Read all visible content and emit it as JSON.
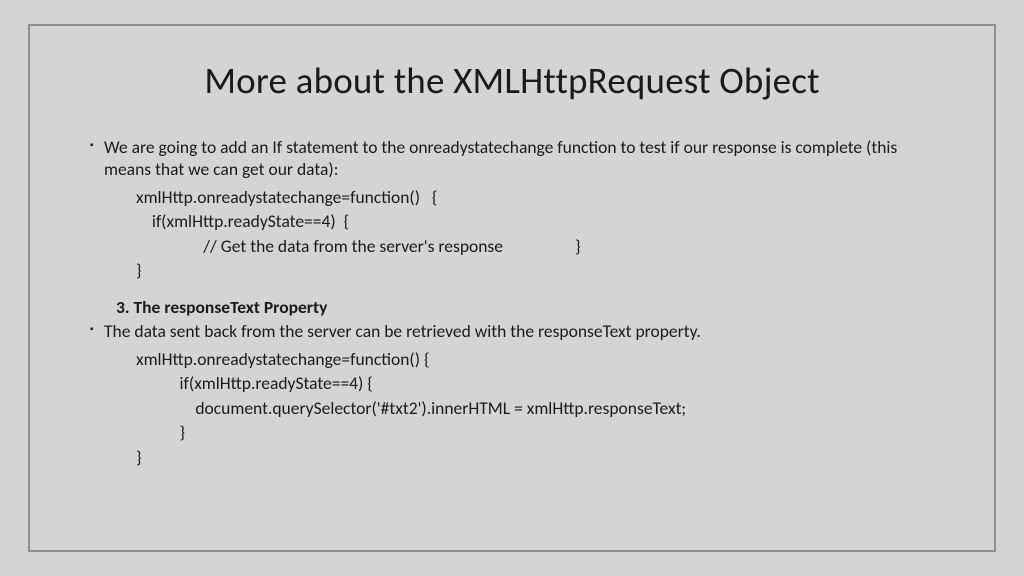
{
  "title": "More about the XMLHttpRequest Object",
  "bullet1": "We are going to add an If statement to the onreadystatechange function to test if our response is complete (this means that we can get our data):",
  "code1": "xmlHttp.onreadystatechange=function()   {\n    if(xmlHttp.readyState==4)  {\n\t         // Get the data from the server's response\t\t       }\n}",
  "section_heading": "3. The responseText Property",
  "bullet2": "The data sent back from the server can be retrieved with the responseText property.",
  "code2": "xmlHttp.onreadystatechange=function() {\n\t   if(xmlHttp.readyState==4) {\n\t       document.querySelector('#txt2').innerHTML = xmlHttp.responseText;\n\t   }\n}"
}
